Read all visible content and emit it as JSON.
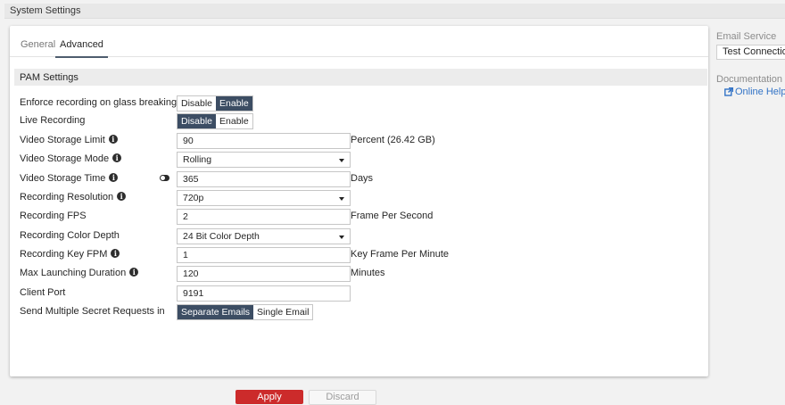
{
  "header": {
    "title": "System Settings"
  },
  "tabs": [
    {
      "label": "General",
      "active": false
    },
    {
      "label": "Advanced",
      "active": true
    }
  ],
  "section": {
    "title": "PAM Settings"
  },
  "rows": {
    "glass_breaking": {
      "label": "Enforce recording on glass breaking",
      "options": [
        "Disable",
        "Enable"
      ],
      "selected": "Enable"
    },
    "live_recording": {
      "label": "Live Recording",
      "options": [
        "Disable",
        "Enable"
      ],
      "selected": "Disable"
    },
    "storage_limit": {
      "label": "Video Storage Limit",
      "value": "90",
      "suffix": "Percent (26.42 GB)"
    },
    "storage_mode": {
      "label": "Video Storage Mode",
      "value": "Rolling"
    },
    "storage_time": {
      "label": "Video Storage Time",
      "value": "365",
      "suffix": "Days"
    },
    "resolution": {
      "label": "Recording Resolution",
      "value": "720p"
    },
    "fps": {
      "label": "Recording FPS",
      "value": "2",
      "suffix": "Frame Per Second"
    },
    "color_depth": {
      "label": "Recording Color Depth",
      "value": "24 Bit Color Depth"
    },
    "key_fpm": {
      "label": "Recording Key FPM",
      "value": "1",
      "suffix": "Key Frame Per Minute"
    },
    "max_launch": {
      "label": "Max Launching Duration",
      "value": "120",
      "suffix": "Minutes"
    },
    "client_port": {
      "label": "Client Port",
      "value": "9191"
    },
    "secret_requests": {
      "label": "Send Multiple Secret Requests in",
      "options": [
        "Separate Emails",
        "Single Email"
      ],
      "selected": "Separate Emails"
    }
  },
  "actions": {
    "apply": "Apply",
    "discard": "Discard"
  },
  "sidebar": {
    "email_service_title": "Email Service",
    "test_connection": "Test Connection",
    "documentation_title": "Documentation",
    "online_help": "Online Help"
  },
  "colors": {
    "accent_dark": "#3c4d63",
    "apply_red": "#cc2b2b",
    "link_blue": "#3273c6"
  },
  "icons": [
    "info-icon",
    "toggle-icon",
    "dropdown-caret-icon",
    "external-link-icon"
  ]
}
